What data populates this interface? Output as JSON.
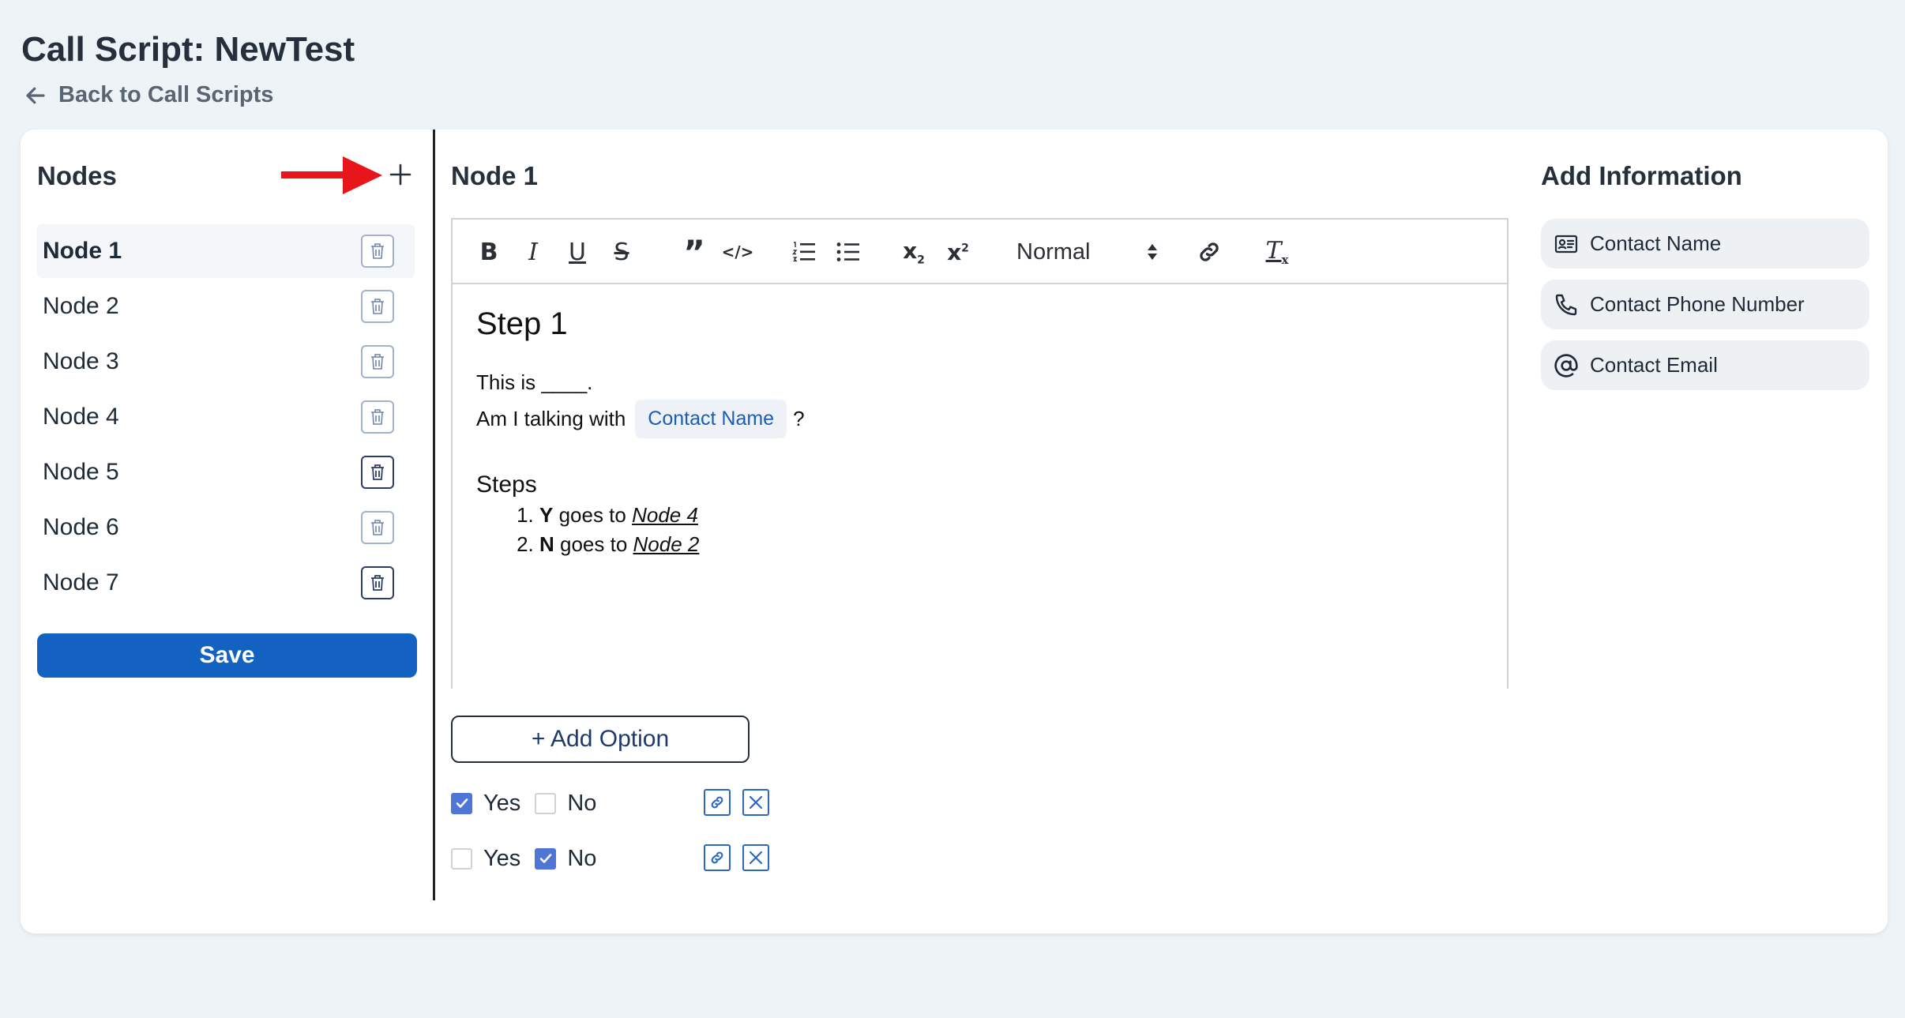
{
  "header": {
    "title": "Call Script: NewTest",
    "back_label": "Back to Call Scripts"
  },
  "nodes_panel": {
    "title": "Nodes",
    "items": [
      {
        "label": "Node 1",
        "active": true
      },
      {
        "label": "Node 2"
      },
      {
        "label": "Node 3"
      },
      {
        "label": "Node 4"
      },
      {
        "label": "Node 5"
      },
      {
        "label": "Node 6"
      },
      {
        "label": "Node 7"
      }
    ],
    "save_label": "Save"
  },
  "editor": {
    "node_title": "Node 1",
    "toolbar": {
      "bold": "B",
      "italic": "I",
      "underline": "U",
      "strike": "S",
      "quote": "”",
      "code": "</>",
      "subscript_base": "x",
      "subscript_mark": "2",
      "superscript_base": "x",
      "superscript_mark": "2",
      "format_select": "Normal",
      "clear_mark": "x",
      "clear_base": "T"
    },
    "content": {
      "heading": "Step 1",
      "line1": "This is ____.",
      "line2_prefix": "Am I talking with",
      "line2_chip": "Contact Name",
      "line2_suffix": "?",
      "steps_heading": "Steps",
      "steps": [
        {
          "key": "Y",
          "text": " goes to ",
          "link": "Node 4"
        },
        {
          "key": "N",
          "text": " goes to ",
          "link": "Node 2"
        }
      ]
    },
    "add_option_label": "+ Add Option",
    "options": [
      {
        "yes_label": "Yes",
        "no_label": "No",
        "yes_checked": true,
        "no_checked": false
      },
      {
        "yes_label": "Yes",
        "no_label": "No",
        "yes_checked": false,
        "no_checked": true
      }
    ]
  },
  "info_panel": {
    "title": "Add Information",
    "items": [
      {
        "label": "Contact Name",
        "icon": "id-card-icon"
      },
      {
        "label": "Contact Phone Number",
        "icon": "phone-icon"
      },
      {
        "label": "Contact Email",
        "icon": "at-sign-icon"
      }
    ]
  },
  "colors": {
    "primary": "#1361c0",
    "checkbox": "#4f76d6",
    "annotation_arrow": "#e8151b"
  }
}
